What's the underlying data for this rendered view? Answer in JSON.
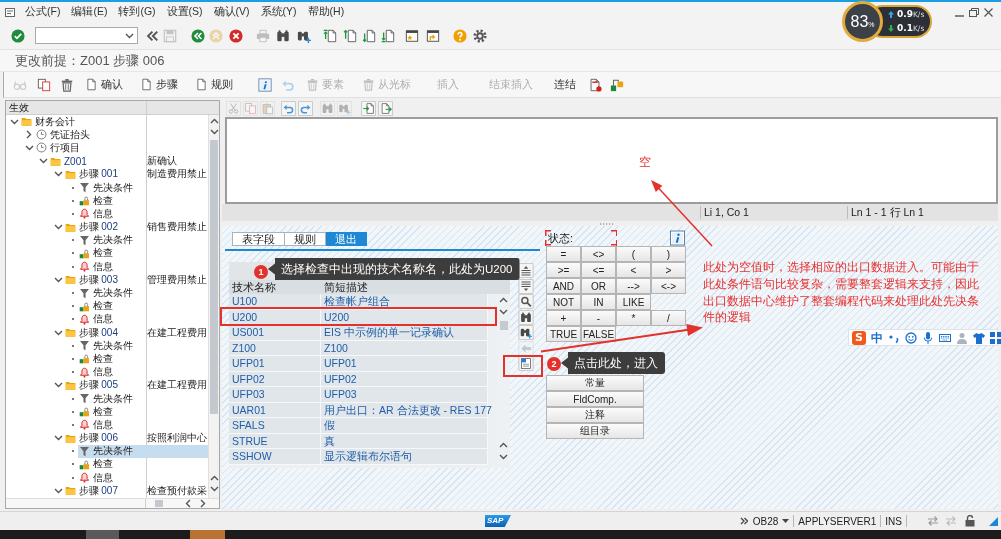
{
  "menu_bar": [
    "公式(F)",
    "编辑(E)",
    "转到(G)",
    "设置(S)",
    "确认(V)",
    "系统(Y)",
    "帮助(H)"
  ],
  "standard_toolbar": [
    {
      "kind": "enter",
      "disabled": false
    },
    {
      "kind": "command_field",
      "disabled": false
    },
    {
      "kind": "back_double",
      "disabled": false
    },
    {
      "kind": "save",
      "disabled": true
    },
    {
      "kind": "back",
      "disabled": false
    },
    {
      "kind": "exit",
      "disabled": true
    },
    {
      "kind": "cancel",
      "disabled": false
    },
    {
      "kind": "print",
      "disabled": true
    },
    {
      "kind": "find",
      "disabled": false
    },
    {
      "kind": "find_next",
      "disabled": false
    },
    {
      "kind": "first_page",
      "disabled": false
    },
    {
      "kind": "previous_page",
      "disabled": false
    },
    {
      "kind": "next_page",
      "disabled": false
    },
    {
      "kind": "last_page",
      "disabled": false
    },
    {
      "kind": "new_session",
      "disabled": false
    },
    {
      "kind": "shortcut",
      "disabled": false
    },
    {
      "kind": "help",
      "disabled": false
    },
    {
      "kind": "settings",
      "disabled": false
    }
  ],
  "screen_title": "更改前提：Z001 步骤 006",
  "application_toolbar": [
    {
      "kind": "display",
      "disabled": true
    },
    {
      "kind": "copy",
      "disabled": false
    },
    {
      "kind": "delete",
      "disabled": false
    },
    {
      "kind": "document",
      "label": "确认",
      "disabled": false
    },
    {
      "kind": "document",
      "label": "步骤",
      "disabled": false
    },
    {
      "kind": "document",
      "label": "规则",
      "disabled": false
    },
    {
      "kind": "info",
      "disabled": false
    },
    {
      "kind": "undo",
      "disabled": true
    },
    {
      "kind": "delete",
      "label": "要素",
      "disabled": true
    },
    {
      "kind": "delete",
      "label": "从光标",
      "disabled": true
    },
    {
      "kind": "text",
      "label": "插入",
      "disabled": true
    },
    {
      "kind": "text",
      "label": "结束插入",
      "disabled": true
    },
    {
      "kind": "text",
      "label": "连结",
      "disabled": false
    },
    {
      "kind": "stop_document",
      "disabled": false
    },
    {
      "kind": "connect",
      "disabled": false
    }
  ],
  "tree": {
    "header": "生效",
    "nodes": [
      {
        "kind": "folder",
        "label": "财务会计",
        "expanded": true,
        "selected": false,
        "children": [
          {
            "kind": "clock",
            "label": "凭证抬头",
            "expanded": false,
            "selected": false
          },
          {
            "kind": "clock",
            "label": "行项目",
            "expanded": true,
            "selected": false,
            "children": [
              {
                "kind": "folder",
                "key": "Z001",
                "description": "新确认",
                "expanded": true,
                "selected": false,
                "children": [
                  {
                    "kind": "folder",
                    "label": "步骤",
                    "key": "001",
                    "description": "制造费用禁止",
                    "expanded": true,
                    "selected": false,
                    "children": [
                      {
                        "kind": "prerequisite",
                        "label": "先决条件",
                        "selected": false
                      },
                      {
                        "kind": "check",
                        "label": "检查",
                        "selected": false
                      },
                      {
                        "kind": "message",
                        "label": "信息",
                        "selected": false
                      }
                    ]
                  },
                  {
                    "kind": "folder",
                    "label": "步骤",
                    "key": "002",
                    "description": "销售费用禁止",
                    "expanded": true,
                    "selected": false,
                    "children": [
                      {
                        "kind": "prerequisite",
                        "label": "先决条件",
                        "selected": false
                      },
                      {
                        "kind": "check",
                        "label": "检查",
                        "selected": false
                      },
                      {
                        "kind": "message",
                        "label": "信息",
                        "selected": false
                      }
                    ]
                  },
                  {
                    "kind": "folder",
                    "label": "步骤",
                    "key": "003",
                    "description": "管理费用禁止",
                    "expanded": true,
                    "selected": false,
                    "children": [
                      {
                        "kind": "prerequisite",
                        "label": "先决条件",
                        "selected": false
                      },
                      {
                        "kind": "check",
                        "label": "检查",
                        "selected": false
                      },
                      {
                        "kind": "message",
                        "label": "信息",
                        "selected": false
                      }
                    ]
                  },
                  {
                    "kind": "folder",
                    "label": "步骤",
                    "key": "004",
                    "description": "在建工程费用",
                    "expanded": true,
                    "selected": false,
                    "children": [
                      {
                        "kind": "prerequisite",
                        "label": "先决条件",
                        "selected": false
                      },
                      {
                        "kind": "check",
                        "label": "检查",
                        "selected": false
                      },
                      {
                        "kind": "message",
                        "label": "信息",
                        "selected": false
                      }
                    ]
                  },
                  {
                    "kind": "folder",
                    "label": "步骤",
                    "key": "005",
                    "description": "在建工程费用",
                    "expanded": true,
                    "selected": false,
                    "children": [
                      {
                        "kind": "prerequisite",
                        "label": "先决条件",
                        "selected": false
                      },
                      {
                        "kind": "check",
                        "label": "检查",
                        "selected": false
                      },
                      {
                        "kind": "message",
                        "label": "信息",
                        "selected": false
                      }
                    ]
                  },
                  {
                    "kind": "folder",
                    "label": "步骤",
                    "key": "006",
                    "description": "按照利润中心",
                    "expanded": true,
                    "selected": false,
                    "children": [
                      {
                        "kind": "prerequisite",
                        "label": "先决条件",
                        "selected": true
                      },
                      {
                        "kind": "check",
                        "label": "检查",
                        "selected": false
                      },
                      {
                        "kind": "message",
                        "label": "信息",
                        "selected": false
                      }
                    ]
                  },
                  {
                    "kind": "folder",
                    "label": "步骤",
                    "key": "007",
                    "description": "检查预付款采",
                    "expanded": true,
                    "selected": false
                  }
                ]
              }
            ]
          }
        ]
      }
    ]
  },
  "editor": {
    "toolbar": [
      {
        "kind": "cut",
        "disabled": true
      },
      {
        "kind": "copy",
        "disabled": true
      },
      {
        "kind": "paste",
        "disabled": true
      },
      {
        "kind": "undo",
        "disabled": false
      },
      {
        "kind": "redo",
        "disabled": false
      },
      {
        "kind": "find",
        "disabled": true
      },
      {
        "kind": "find_next",
        "disabled": true
      },
      {
        "kind": "import",
        "disabled": false
      },
      {
        "kind": "export",
        "disabled": false
      }
    ],
    "cursor_position": "Li 1, Co 1",
    "line_info": "Ln 1 - 1 行 Ln 1"
  },
  "exit_panel": {
    "tabs": [
      {
        "label": "表字段",
        "selected": false
      },
      {
        "label": "规则",
        "selected": false
      },
      {
        "label": "退出",
        "selected": true
      }
    ],
    "table": {
      "columns": [
        "技术名称",
        "简短描述"
      ],
      "rows": [
        [
          "U100",
          "检查帐户组合"
        ],
        [
          "U200",
          "U200"
        ],
        [
          "US001",
          "EIS 中示例的单一记录确认"
        ],
        [
          "Z100",
          "Z100"
        ],
        [
          "UFP01",
          "UFP01"
        ],
        [
          "UFP02",
          "UFP02"
        ],
        [
          "UFP03",
          "UFP03"
        ],
        [
          "UAR01",
          "用户出口：AR 合法更改 - RES 177"
        ],
        [
          "SFALS",
          "假"
        ],
        [
          "STRUE",
          "真"
        ],
        [
          "SSHOW",
          "显示逻辑布尔语句"
        ]
      ]
    },
    "side_toolbar": [
      {
        "kind": "sort_up",
        "disabled": false
      },
      {
        "kind": "sort_down",
        "disabled": false
      },
      {
        "kind": "search",
        "disabled": false
      },
      {
        "kind": "find",
        "disabled": false
      },
      {
        "kind": "find_next",
        "disabled": false
      },
      {
        "kind": "back_arrow",
        "disabled": true
      },
      {
        "kind": "exit_data",
        "disabled": false
      }
    ],
    "status_label": "状态:",
    "operators": [
      [
        "=",
        "<>",
        "(",
        ")"
      ],
      [
        ">=",
        "<=",
        "<",
        ">"
      ],
      [
        "AND",
        "OR",
        "-->",
        "<->"
      ],
      [
        "NOT",
        "IN",
        "LIKE"
      ],
      [
        "+",
        "-",
        "*",
        "/"
      ],
      [
        "TRUE",
        "FALSE"
      ]
    ],
    "function_buttons": [
      "常量",
      "FldComp.",
      "注释",
      "组目录"
    ]
  },
  "annotations": {
    "callouts": [
      {
        "number": "1",
        "text": "选择检查中出现的技术名称名，此处为U200"
      },
      {
        "number": "2",
        "text": "点击此处，进入"
      }
    ],
    "notes": [
      "空",
      "此处为空值时，选择相应的出口数据进入。可能由于此处条件语句比较复杂，需要整套逻辑来支持，因此出口数据中心维护了整套编程代码来处理此处先决条件的逻辑"
    ]
  },
  "speed_monitor": {
    "percent": "83",
    "percent_unit": "%",
    "upload": {
      "value": "0.9",
      "unit": "K/s"
    },
    "download": {
      "value": "0.1",
      "unit": "K/s"
    }
  },
  "ime_toolbar": {
    "logo": "S",
    "mode": "中"
  },
  "status_bar": {
    "logo": "SAP",
    "transaction": "OB28",
    "server": "APPLYSERVER1",
    "input_mode": "INS"
  }
}
